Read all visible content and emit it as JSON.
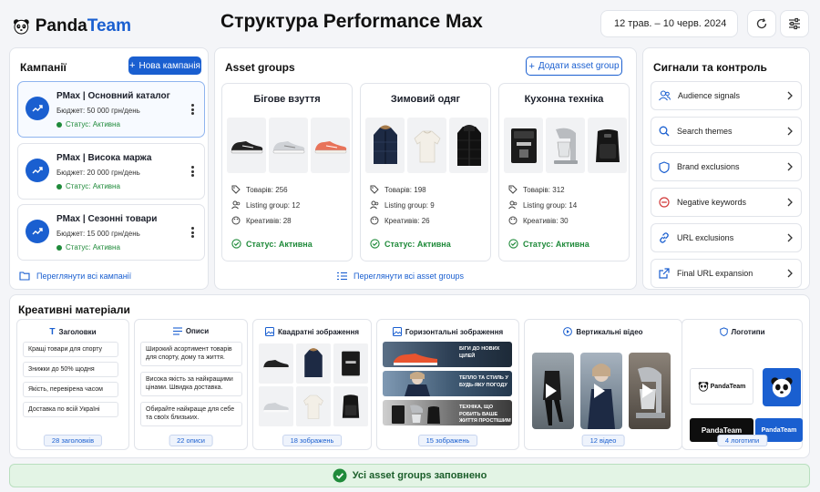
{
  "app": {
    "brand_plain": "Panda",
    "brand_accent": "Team"
  },
  "page_title": "Структура Performance Max",
  "header": {
    "date_range": "12 трав. – 10 черв. 2024"
  },
  "campaigns": {
    "title": "Кампанії",
    "new_button": "Нова кампанія",
    "items": [
      {
        "name": "PMax | Основний каталог",
        "budget": "Бюджет: 50 000 грн/день",
        "status": "Статус: Активна",
        "selected": true
      },
      {
        "name": "PMax | Висока маржа",
        "budget": "Бюджет: 20 000 грн/день",
        "status": "Статус: Активна",
        "selected": false
      },
      {
        "name": "PMax | Сезонні товари",
        "budget": "Бюджет: 15 000 грн/день",
        "status": "Статус: Активна",
        "selected": false
      }
    ],
    "view_all": "Переглянути всі кампанії"
  },
  "asset_groups": {
    "title": "Asset groups",
    "add_button": "Додати asset group",
    "items": [
      {
        "name": "Бігове взуття",
        "products": "Товарів: 256",
        "listing": "Listing group: 12",
        "creatives": "Креативів: 28",
        "status": "Статус: Активна"
      },
      {
        "name": "Зимовий одяг",
        "products": "Товарів: 198",
        "listing": "Listing group: 9",
        "creatives": "Креативів: 26",
        "status": "Статус: Активна"
      },
      {
        "name": "Кухонна техніка",
        "products": "Товарів: 312",
        "listing": "Listing group: 14",
        "creatives": "Креативів: 30",
        "status": "Статус: Активна"
      }
    ],
    "view_all": "Переглянути всі asset groups"
  },
  "signals": {
    "title": "Сигнали та контроль",
    "items": [
      {
        "label": "Audience signals",
        "icon": "users-icon"
      },
      {
        "label": "Search themes",
        "icon": "search-icon"
      },
      {
        "label": "Brand exclusions",
        "icon": "shield-icon"
      },
      {
        "label": "Negative keywords",
        "icon": "minus-circle-icon"
      },
      {
        "label": "URL exclusions",
        "icon": "link-icon"
      },
      {
        "label": "Final URL expansion",
        "icon": "external-link-icon"
      }
    ]
  },
  "creatives": {
    "title": "Креативні матеріали",
    "headlines": {
      "title": "Заголовки",
      "items": [
        "Кращі товари для спорту",
        "Знижки до 50% щодня",
        "Якість, перевірена часом",
        "Доставка по всій Україні"
      ],
      "count": "28 заголовків"
    },
    "descriptions": {
      "title": "Описи",
      "items": [
        "Широкий асортимент товарів для спорту, дому та життя.",
        "Висока якість за найкращими цінами. Швидка доставка.",
        "Обирайте найкраще для себе та своїх близьких."
      ],
      "count": "22 описи"
    },
    "square_images": {
      "title": "Квадратні зображення",
      "count": "18 зображень"
    },
    "horizontal_images": {
      "title": "Горизонтальні зображення",
      "banners": [
        "БІГИ ДО НОВИХ ЦІЛЕЙ",
        "ТЕПЛО ТА СТИЛЬ У БУДЬ-ЯКУ ПОГОДУ",
        "ТЕХНІКА, ЩО РОБИТЬ ВАШЕ ЖИТТЯ ПРОСТІШИМ"
      ],
      "count": "15 зображень"
    },
    "vertical_video": {
      "title": "Вертикальні відео",
      "count": "12 відео"
    },
    "logos": {
      "title": "Логотипи",
      "count": "4 логотипи",
      "wordmark": "PandaTeam"
    }
  },
  "footer": {
    "message": "Усі asset groups заповнено"
  },
  "colors": {
    "accent": "#1a5fd0",
    "success": "#1f8a3a"
  }
}
